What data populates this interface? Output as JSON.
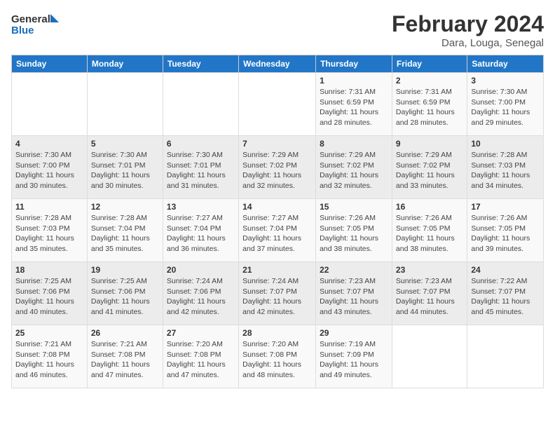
{
  "logo": {
    "general": "General",
    "blue": "Blue"
  },
  "title": "February 2024",
  "subtitle": "Dara, Louga, Senegal",
  "days_of_week": [
    "Sunday",
    "Monday",
    "Tuesday",
    "Wednesday",
    "Thursday",
    "Friday",
    "Saturday"
  ],
  "weeks": [
    [
      {
        "day": "",
        "info": ""
      },
      {
        "day": "",
        "info": ""
      },
      {
        "day": "",
        "info": ""
      },
      {
        "day": "",
        "info": ""
      },
      {
        "day": "1",
        "info": "Sunrise: 7:31 AM\nSunset: 6:59 PM\nDaylight: 11 hours and 28 minutes."
      },
      {
        "day": "2",
        "info": "Sunrise: 7:31 AM\nSunset: 6:59 PM\nDaylight: 11 hours and 28 minutes."
      },
      {
        "day": "3",
        "info": "Sunrise: 7:30 AM\nSunset: 7:00 PM\nDaylight: 11 hours and 29 minutes."
      }
    ],
    [
      {
        "day": "4",
        "info": "Sunrise: 7:30 AM\nSunset: 7:00 PM\nDaylight: 11 hours and 30 minutes."
      },
      {
        "day": "5",
        "info": "Sunrise: 7:30 AM\nSunset: 7:01 PM\nDaylight: 11 hours and 30 minutes."
      },
      {
        "day": "6",
        "info": "Sunrise: 7:30 AM\nSunset: 7:01 PM\nDaylight: 11 hours and 31 minutes."
      },
      {
        "day": "7",
        "info": "Sunrise: 7:29 AM\nSunset: 7:02 PM\nDaylight: 11 hours and 32 minutes."
      },
      {
        "day": "8",
        "info": "Sunrise: 7:29 AM\nSunset: 7:02 PM\nDaylight: 11 hours and 32 minutes."
      },
      {
        "day": "9",
        "info": "Sunrise: 7:29 AM\nSunset: 7:02 PM\nDaylight: 11 hours and 33 minutes."
      },
      {
        "day": "10",
        "info": "Sunrise: 7:28 AM\nSunset: 7:03 PM\nDaylight: 11 hours and 34 minutes."
      }
    ],
    [
      {
        "day": "11",
        "info": "Sunrise: 7:28 AM\nSunset: 7:03 PM\nDaylight: 11 hours and 35 minutes."
      },
      {
        "day": "12",
        "info": "Sunrise: 7:28 AM\nSunset: 7:04 PM\nDaylight: 11 hours and 35 minutes."
      },
      {
        "day": "13",
        "info": "Sunrise: 7:27 AM\nSunset: 7:04 PM\nDaylight: 11 hours and 36 minutes."
      },
      {
        "day": "14",
        "info": "Sunrise: 7:27 AM\nSunset: 7:04 PM\nDaylight: 11 hours and 37 minutes."
      },
      {
        "day": "15",
        "info": "Sunrise: 7:26 AM\nSunset: 7:05 PM\nDaylight: 11 hours and 38 minutes."
      },
      {
        "day": "16",
        "info": "Sunrise: 7:26 AM\nSunset: 7:05 PM\nDaylight: 11 hours and 38 minutes."
      },
      {
        "day": "17",
        "info": "Sunrise: 7:26 AM\nSunset: 7:05 PM\nDaylight: 11 hours and 39 minutes."
      }
    ],
    [
      {
        "day": "18",
        "info": "Sunrise: 7:25 AM\nSunset: 7:06 PM\nDaylight: 11 hours and 40 minutes."
      },
      {
        "day": "19",
        "info": "Sunrise: 7:25 AM\nSunset: 7:06 PM\nDaylight: 11 hours and 41 minutes."
      },
      {
        "day": "20",
        "info": "Sunrise: 7:24 AM\nSunset: 7:06 PM\nDaylight: 11 hours and 42 minutes."
      },
      {
        "day": "21",
        "info": "Sunrise: 7:24 AM\nSunset: 7:07 PM\nDaylight: 11 hours and 42 minutes."
      },
      {
        "day": "22",
        "info": "Sunrise: 7:23 AM\nSunset: 7:07 PM\nDaylight: 11 hours and 43 minutes."
      },
      {
        "day": "23",
        "info": "Sunrise: 7:23 AM\nSunset: 7:07 PM\nDaylight: 11 hours and 44 minutes."
      },
      {
        "day": "24",
        "info": "Sunrise: 7:22 AM\nSunset: 7:07 PM\nDaylight: 11 hours and 45 minutes."
      }
    ],
    [
      {
        "day": "25",
        "info": "Sunrise: 7:21 AM\nSunset: 7:08 PM\nDaylight: 11 hours and 46 minutes."
      },
      {
        "day": "26",
        "info": "Sunrise: 7:21 AM\nSunset: 7:08 PM\nDaylight: 11 hours and 47 minutes."
      },
      {
        "day": "27",
        "info": "Sunrise: 7:20 AM\nSunset: 7:08 PM\nDaylight: 11 hours and 47 minutes."
      },
      {
        "day": "28",
        "info": "Sunrise: 7:20 AM\nSunset: 7:08 PM\nDaylight: 11 hours and 48 minutes."
      },
      {
        "day": "29",
        "info": "Sunrise: 7:19 AM\nSunset: 7:09 PM\nDaylight: 11 hours and 49 minutes."
      },
      {
        "day": "",
        "info": ""
      },
      {
        "day": "",
        "info": ""
      }
    ]
  ]
}
